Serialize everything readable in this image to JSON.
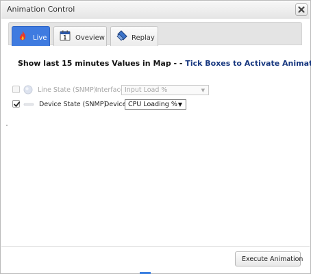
{
  "window": {
    "title": "Animation Control"
  },
  "tabs": [
    {
      "label": "Live",
      "icon": "flame-icon",
      "active": true
    },
    {
      "label": "Oveview",
      "icon": "calendar-icon",
      "active": false
    },
    {
      "label": "Replay",
      "icon": "tag-icon",
      "active": false
    }
  ],
  "headline": {
    "text": "Show last 15 minutes Values in Map - - ",
    "accent": "Tick Boxes to Activate Animation"
  },
  "rows": [
    {
      "checked": false,
      "enabled": false,
      "label": "Line State (SNMP)",
      "selector_label": "Interface",
      "selected_value": "Input Load %"
    },
    {
      "checked": true,
      "enabled": true,
      "label": "Device State (SNMP)",
      "selector_label": "Device",
      "selected_value": "CPU Loading %"
    }
  ],
  "footer": {
    "execute_label": "Execute Animation"
  },
  "colors": {
    "active_tab": "#3f7be0",
    "headline_accent": "#17377f"
  }
}
